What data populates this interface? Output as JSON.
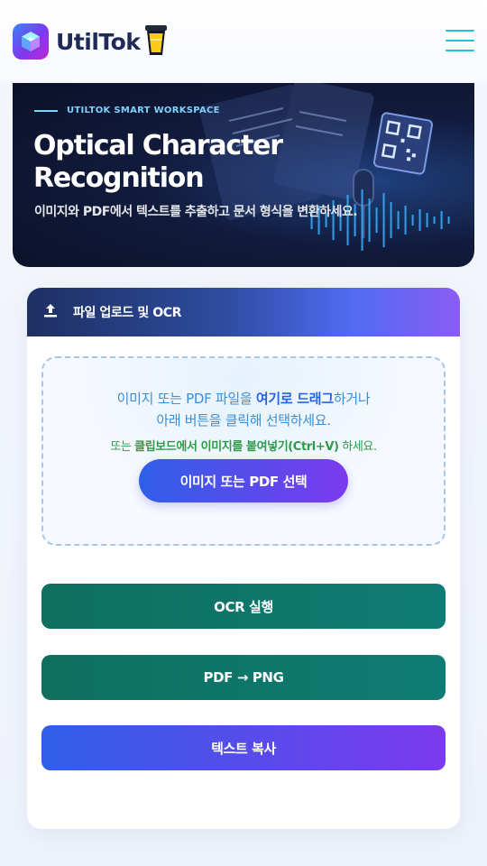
{
  "header": {
    "brand": "UtilTok",
    "menu_icon": "hamburger-menu-icon",
    "logo_icon": "cube-logo-icon",
    "mascot_icon": "cup-icon",
    "accent_color": "#1cc4d8"
  },
  "hero": {
    "eyebrow": "UTILTOK SMART WORKSPACE",
    "title": "Optical Character Recognition",
    "subtitle": "이미지와 PDF에서 텍스트를 추출하고 문서 형식을 변환하세요."
  },
  "card": {
    "title": "파일 업로드 및 OCR",
    "header_icon": "upload-icon",
    "dropzone": {
      "line1_prefix": "이미지 또는 PDF 파일을 ",
      "line1_bold": "여기로 드래그",
      "line1_suffix": "하거나",
      "line2": "아래 버튼을 클릭해 선택하세요.",
      "line3_prefix": "또는 ",
      "line3_bold": "클립보드에서 이미지를 붙여넣기(Ctrl+V)",
      "line3_suffix": " 하세요.",
      "select_button": "이미지 또는 PDF 선택"
    },
    "buttons": {
      "ocr": "OCR 실행",
      "pdf_to_png": "PDF → PNG",
      "copy_text": "텍스트 복사"
    }
  },
  "colors": {
    "primary_gradient_start": "#2f5fe8",
    "primary_gradient_end": "#7c3aed",
    "action_green": "#0f766e",
    "hint_green": "#2f9a4a",
    "hint_blue": "#3a8fd6"
  }
}
